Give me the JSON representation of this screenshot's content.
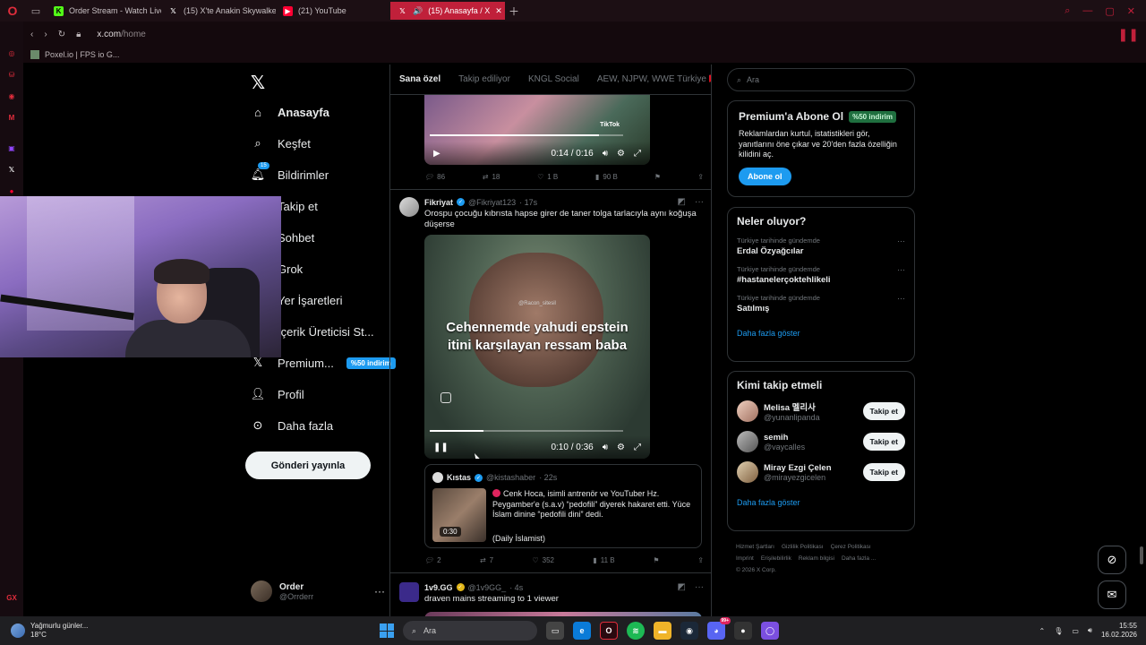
{
  "browser": {
    "tabs": [
      {
        "label": "Order Stream - Watch Live",
        "fav_color": "#53fc18",
        "fav_text": "K"
      },
      {
        "label": "(15) X'te Anakin Skywalker",
        "fav_color": "#000000",
        "fav_text": "X"
      },
      {
        "label": "(21) YouTube",
        "fav_color": "#ff0033",
        "fav_text": "▶"
      },
      {
        "label": "(15) Anasayfa / X",
        "fav_color": "#000000",
        "fav_text": "X"
      }
    ],
    "url_host": "x.com",
    "url_path": "/home",
    "bookmark": "Poxel.io | FPS io G..."
  },
  "nav": {
    "items": [
      {
        "label": "Anasayfa",
        "icon": "home-icon"
      },
      {
        "label": "Keşfet",
        "icon": "search-icon"
      },
      {
        "label": "Bildirimler",
        "icon": "bell-icon",
        "badge": "15"
      },
      {
        "label": "Takip et",
        "icon": "follow-icon"
      },
      {
        "label": "Sohbet",
        "icon": "chat-icon"
      },
      {
        "label": "Grok",
        "icon": "grok-icon"
      },
      {
        "label": "Yer İşaretleri",
        "icon": "bookmark-icon"
      },
      {
        "label": "İçerik Üreticisi St...",
        "icon": "creator-icon"
      },
      {
        "label": "Premium...",
        "icon": "x-premium-icon",
        "pill": "%50 indirim"
      },
      {
        "label": "Profil",
        "icon": "profile-icon"
      },
      {
        "label": "Daha fazla",
        "icon": "more-icon"
      }
    ],
    "post_button": "Gönderi yayınla",
    "account_name": "Order",
    "account_handle": "@Orrderr"
  },
  "timeline": {
    "tabs": [
      "Sana özel",
      "Takip ediliyor",
      "KNGL Social",
      "AEW, NJPW, WWE Türkiye 🇹🇷"
    ],
    "top_post": {
      "time": "0:14 / 0:16",
      "watermark": "TikTok",
      "progress": 0.875,
      "replies": "86",
      "reposts": "18",
      "likes": "1 B",
      "views": "90 B"
    },
    "post1": {
      "name": "Fikriyat",
      "handle": "@Fikriyat123",
      "age": "· 17s",
      "text": "Orospu çocuğu kıbrısta hapse girer de taner tolga tarlacıyla aynı koğuşa düşerse",
      "video_watermark": "@Racon_sitesil",
      "video_caption": "Cehennemde yahudi epstein itini karşılayan ressam baba",
      "time": "0:10 / 0:36",
      "progress": 0.28,
      "quote": {
        "name": "Kıstas",
        "handle": "@kistashaber",
        "age": "· 22s",
        "text": "Cenk Hoca, isimli antrenör ve YouTuber Hz. Peygamber'e (s.a.v) “pedofili” diyerek hakaret etti. Yüce İslam dinine “pedofili dini” dedi.",
        "source": "(Daily İslamist)",
        "duration": "0:30"
      },
      "replies": "2",
      "reposts": "7",
      "likes": "352",
      "views": "11 B"
    },
    "post2": {
      "name": "1v9.GG",
      "handle": "@1v9GG_",
      "age": "· 4s",
      "text": "draven mains streaming to 1 viewer"
    }
  },
  "right": {
    "search_placeholder": "Ara",
    "premium": {
      "title": "Premium'a Abone Ol",
      "pill": "%50 indirim",
      "text": "Reklamlardan kurtul, istatistikleri gör, yanıtlarını öne çıkar ve 20'den fazla özelliğin kilidini aç.",
      "button": "Abone ol"
    },
    "trends": {
      "title": "Neler oluyor?",
      "items": [
        {
          "context": "Türkiye tarihinde gündemde",
          "title": "Erdal Özyağcılar"
        },
        {
          "context": "Türkiye tarihinde gündemde",
          "title": "#hastanelerçoktehlikeli"
        },
        {
          "context": "Türkiye tarihinde gündemde",
          "title": "Satılmış"
        }
      ],
      "more": "Daha fazla göster"
    },
    "follow": {
      "title": "Kimi takip etmeli",
      "items": [
        {
          "name": "Melisa 멜리사",
          "handle": "@yunanlipanda",
          "button": "Takip et"
        },
        {
          "name": "semih",
          "handle": "@vaycalles",
          "button": "Takip et"
        },
        {
          "name": "Miray Ezgi Çelen",
          "handle": "@mirayezgicelen",
          "button": "Takip et"
        }
      ],
      "more": "Daha fazla göster"
    },
    "footer": [
      "Hizmet Şartları",
      "Gizlilik Politikası",
      "Çerez Politikası",
      "Imprint",
      "Erişilebilirlik",
      "Reklam bilgisi",
      "Daha fazla ...",
      "© 2026 X Corp."
    ]
  },
  "taskbar": {
    "weather_text": "Yağmurlu günler...",
    "weather_temp": "18°C",
    "search_placeholder": "Ara",
    "time": "15:55",
    "date": "16.02.2026",
    "notif_badge": "99+"
  }
}
